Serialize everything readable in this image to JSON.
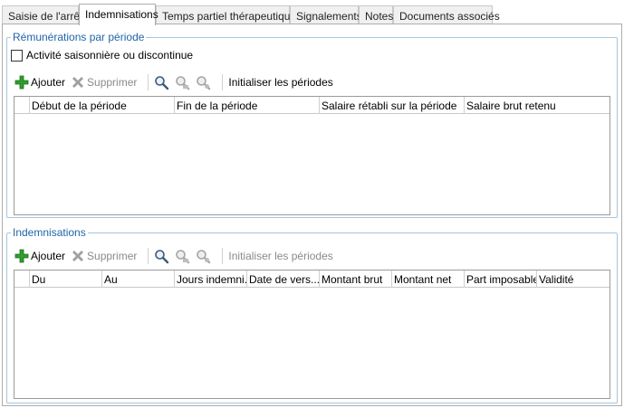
{
  "tabs": [
    {
      "label": "Saisie de l'arrêt",
      "active": false
    },
    {
      "label": "Indemnisations",
      "active": true
    },
    {
      "label": "Temps partiel thérapeutique",
      "active": false
    },
    {
      "label": "Signalements",
      "active": false
    },
    {
      "label": "Notes",
      "active": false
    },
    {
      "label": "Documents associés",
      "active": false
    }
  ],
  "remunerations": {
    "title": "Rémunérations par période",
    "checkbox_label": "Activité saisonnière ou discontinue",
    "checkbox_checked": false,
    "toolbar": {
      "add_label": "Ajouter",
      "delete_label": "Supprimer",
      "init_label": "Initialiser les périodes"
    },
    "columns": [
      "Début de la période",
      "Fin de la période",
      "Salaire rétabli sur la période",
      "Salaire brut retenu"
    ]
  },
  "indemnisations": {
    "title": "Indemnisations",
    "toolbar": {
      "add_label": "Ajouter",
      "delete_label": "Supprimer",
      "init_label": "Initialiser les périodes"
    },
    "columns": [
      "Du",
      "Au",
      "Jours indemni...",
      "Date de vers...",
      "Montant brut",
      "Montant net",
      "Part imposable",
      "Validité"
    ]
  },
  "colors": {
    "accent": "#1f64a6",
    "group_border": "#a6c5de",
    "add_green": "#2e9e2e",
    "disabled_gray": "#9a9a9a"
  },
  "icons": {
    "add": "plus-icon",
    "delete": "x-icon",
    "search": "magnifier-icon",
    "filter": "filter-icon",
    "settings": "filter-settings-icon"
  }
}
